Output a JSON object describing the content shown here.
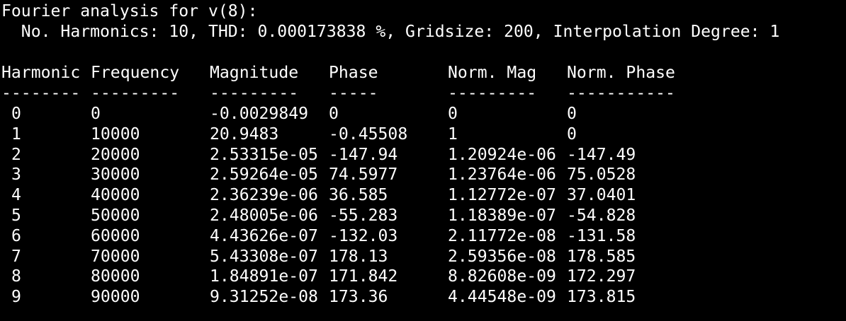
{
  "terminal": {
    "title_line": "Fourier analysis for v(8):",
    "info_line": "  No. Harmonics: 10, THD: 0.000173838 %, Gridsize: 200, Interpolation Degree: 1",
    "headers": [
      "Harmonic",
      "Frequency",
      "Magnitude",
      "Phase",
      "Norm. Mag",
      "Norm. Phase"
    ],
    "dashes": [
      "--------",
      "---------",
      "---------",
      "-----",
      "---------",
      "-----------"
    ],
    "rows": [
      [
        "0",
        "0",
        "-0.0029849",
        "0",
        "0",
        "0"
      ],
      [
        "1",
        "10000",
        "20.9483",
        "-0.45508",
        "1",
        "0"
      ],
      [
        "2",
        "20000",
        "2.53315e-05",
        "-147.94",
        "1.20924e-06",
        "-147.49"
      ],
      [
        "3",
        "30000",
        "2.59264e-05",
        "74.5977",
        "1.23764e-06",
        "75.0528"
      ],
      [
        "4",
        "40000",
        "2.36239e-06",
        "36.585",
        "1.12772e-07",
        "37.0401"
      ],
      [
        "5",
        "50000",
        "2.48005e-06",
        "-55.283",
        "1.18389e-07",
        "-54.828"
      ],
      [
        "6",
        "60000",
        "4.43626e-07",
        "-132.03",
        "2.11772e-08",
        "-131.58"
      ],
      [
        "7",
        "70000",
        "5.43308e-07",
        "178.13",
        "2.59356e-08",
        "178.585"
      ],
      [
        "8",
        "80000",
        "1.84891e-07",
        "171.842",
        "8.82608e-09",
        "172.297"
      ],
      [
        "9",
        "90000",
        "9.31252e-08",
        "173.36",
        "4.44548e-09",
        "173.815"
      ]
    ]
  }
}
